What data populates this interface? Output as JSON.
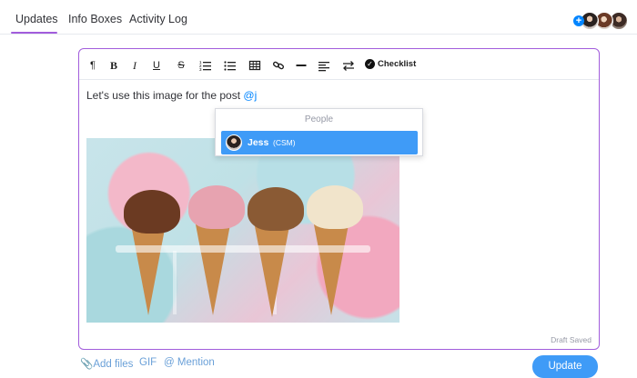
{
  "tabs": [
    {
      "label": "Updates",
      "active": true
    },
    {
      "label": "Info Boxes",
      "active": false
    },
    {
      "label": "Activity Log",
      "active": false
    }
  ],
  "subscribers": {
    "add_icon": "plus-icon",
    "count_visible": 3
  },
  "toolbar": {
    "icons": [
      "paragraph-icon",
      "bold-icon",
      "italic-icon",
      "underline-icon",
      "strikethrough-icon",
      "ordered-list-icon",
      "bullet-list-icon",
      "table-icon",
      "link-icon",
      "divider-icon",
      "align-icon",
      "direction-icon",
      "checklist-icon"
    ],
    "bold": "B",
    "italic": "I",
    "underline": "U",
    "strike": "S",
    "paragraph": "¶",
    "checklist_label": "Checklist"
  },
  "editor": {
    "text": "Let's use this image for the post ",
    "mention_fragment": "@j",
    "draft_status": "Draft Saved"
  },
  "mention_dropdown": {
    "header": "People",
    "items": [
      {
        "name": "Jess",
        "role": "(CSM)",
        "selected": true
      }
    ]
  },
  "actions": {
    "add_files": "Add files",
    "gif": "GIF",
    "mention": "Mention",
    "update": "Update"
  },
  "colors": {
    "accent": "#a25ddc",
    "primary": "#3f9bf7",
    "link": "#6aa0d8"
  }
}
